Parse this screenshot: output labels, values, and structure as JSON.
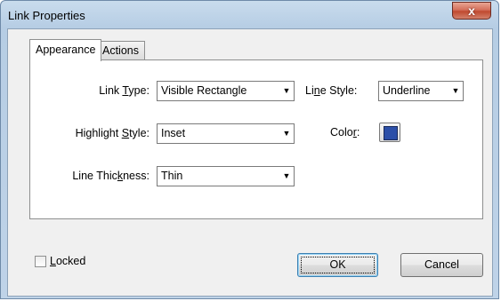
{
  "window": {
    "title": "Link Properties",
    "close_glyph": "x"
  },
  "tabs": [
    {
      "label": "Appearance",
      "active": true
    },
    {
      "label": "Actions",
      "active": false
    }
  ],
  "appearance": {
    "link_type": {
      "label_pre": "Link ",
      "label_key": "T",
      "label_post": "ype:",
      "value": "Visible Rectangle"
    },
    "highlight_style": {
      "label_pre": "Highlight ",
      "label_key": "S",
      "label_post": "tyle:",
      "value": "Inset"
    },
    "line_thickness": {
      "label_pre": "Line Thic",
      "label_key": "k",
      "label_post": "ness:",
      "value": "Thin"
    },
    "line_style": {
      "label_pre": "Li",
      "label_key": "n",
      "label_post": "e Style:",
      "value": "Underline"
    },
    "color": {
      "label_pre": "Colo",
      "label_key": "r",
      "label_post": ":",
      "value": "#2c4fa8"
    }
  },
  "locked": {
    "label_key": "L",
    "label_post": "ocked",
    "checked": false
  },
  "buttons": {
    "ok": "OK",
    "cancel": "Cancel"
  },
  "icons": {
    "dropdown": "chevron-down-icon",
    "close": "close-icon"
  },
  "colors": {
    "title_bar": "#bfd3e8",
    "close_button": "#c7503a",
    "dialog_bg": "#f0f0f0",
    "color_swatch": "#2c4fa8"
  }
}
